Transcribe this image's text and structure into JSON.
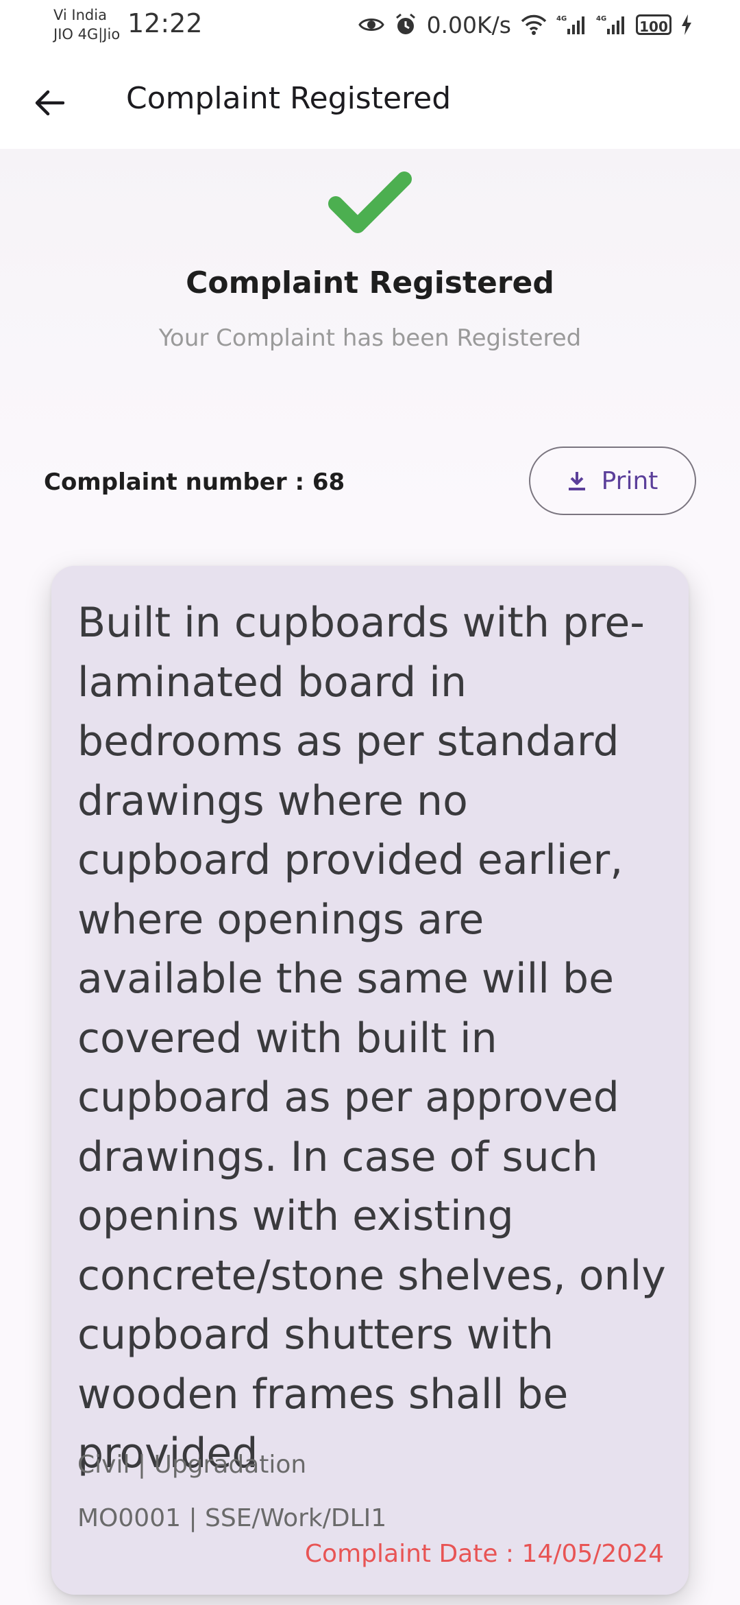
{
  "status_bar": {
    "carrier_line1": "Vi India",
    "carrier_line2": "JIO 4G|Jio",
    "time": "12:22",
    "net_speed": "0.00K/s",
    "battery_level": "100",
    "icons": [
      "eye-icon",
      "alarm-icon",
      "wifi-icon",
      "signal-4g-icon",
      "signal-4g-icon",
      "battery-icon",
      "charging-icon"
    ]
  },
  "app_bar": {
    "title": "Complaint Registered",
    "back_icon": "arrow-left-icon"
  },
  "confirmation": {
    "icon": "checkmark-icon",
    "icon_color": "#4caf50",
    "heading": "Complaint Registered",
    "subheading": "Your Complaint has been Registered"
  },
  "complaint": {
    "number_text": "Complaint number : 68",
    "print_label": "Print",
    "print_icon": "download-icon",
    "accent_color": "#5b3f9a"
  },
  "card": {
    "description": "Built in cupboards with pre-laminated board in bedrooms as per standard drawings where no cupboard provided earlier, where openings are available the same will be covered with built in cupboard as per approved drawings. In case of such openins with existing concrete/stone shelves, only cupboard shutters with wooden frames shall be provided",
    "category": "Civil | Upgradation",
    "code": "MO0001 | SSE/Work/DLI1",
    "date_text": "Complaint Date : 14/05/2024",
    "date_color": "#e85454"
  }
}
